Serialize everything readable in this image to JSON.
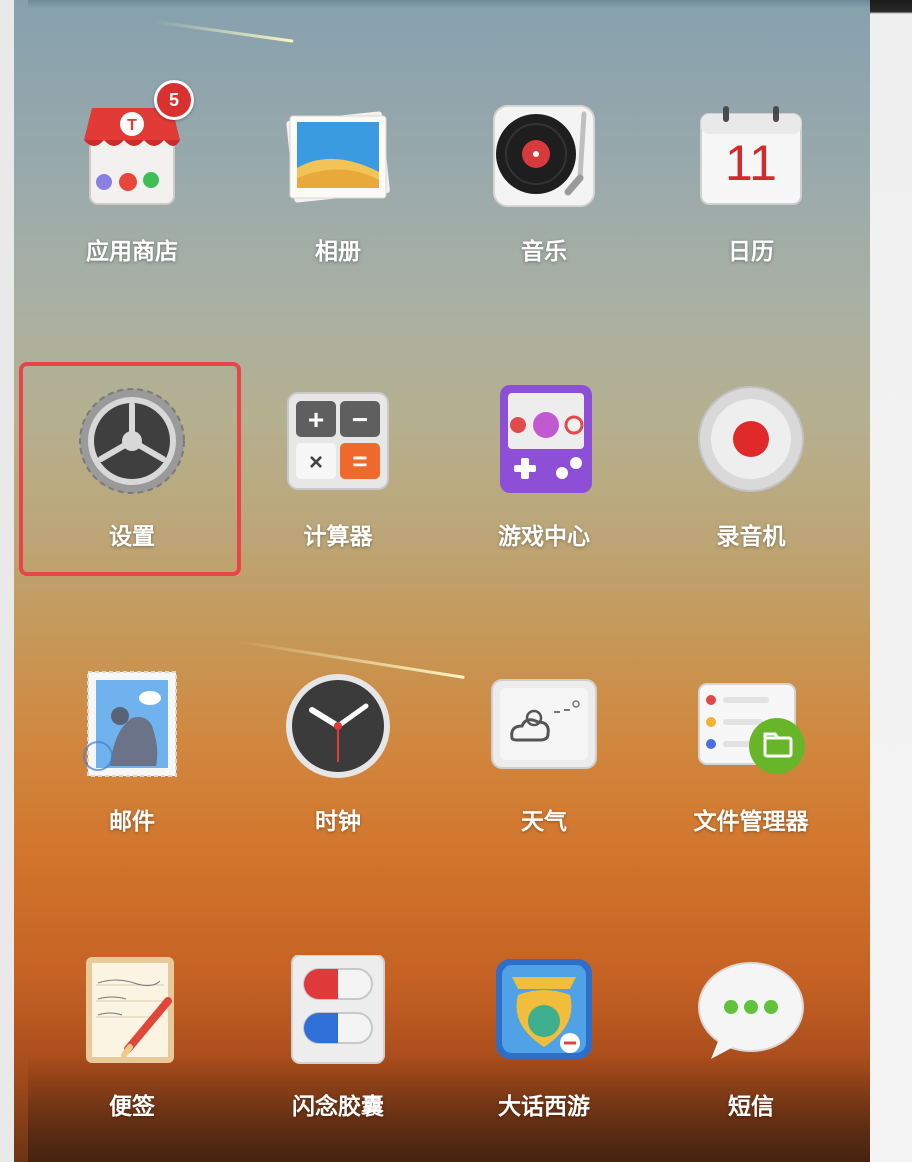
{
  "apps": [
    {
      "id": "app-store",
      "label": "应用商店",
      "icon": "store-icon",
      "badge": "5",
      "highlighted": false
    },
    {
      "id": "photos",
      "label": "相册",
      "icon": "photos-icon",
      "highlighted": false
    },
    {
      "id": "music",
      "label": "音乐",
      "icon": "turntable-icon",
      "highlighted": false
    },
    {
      "id": "calendar",
      "label": "日历",
      "icon": "calendar-icon",
      "day": "11",
      "highlighted": false
    },
    {
      "id": "settings",
      "label": "设置",
      "icon": "gear-icon",
      "highlighted": true
    },
    {
      "id": "calculator",
      "label": "计算器",
      "icon": "calculator-icon",
      "highlighted": false
    },
    {
      "id": "game-center",
      "label": "游戏中心",
      "icon": "gamepad-icon",
      "highlighted": false
    },
    {
      "id": "recorder",
      "label": "录音机",
      "icon": "record-icon",
      "highlighted": false
    },
    {
      "id": "mail",
      "label": "邮件",
      "icon": "stamp-icon",
      "highlighted": false
    },
    {
      "id": "clock",
      "label": "时钟",
      "icon": "clock-icon",
      "highlighted": false
    },
    {
      "id": "weather",
      "label": "天气",
      "icon": "weather-icon",
      "highlighted": false
    },
    {
      "id": "file-manager",
      "label": "文件管理器",
      "icon": "folder-icon",
      "highlighted": false
    },
    {
      "id": "notes",
      "label": "便签",
      "icon": "notepad-icon",
      "highlighted": false
    },
    {
      "id": "flash-capsule",
      "label": "闪念胶囊",
      "icon": "capsule-icon",
      "highlighted": false
    },
    {
      "id": "westward-journey",
      "label": "大话西游",
      "icon": "game-logo-icon",
      "highlighted": false
    },
    {
      "id": "sms",
      "label": "短信",
      "icon": "chat-bubble-icon",
      "highlighted": false
    }
  ],
  "colors": {
    "highlight_border": "#e8454b",
    "badge": "#d9322e",
    "label_text": "#ffffff"
  }
}
